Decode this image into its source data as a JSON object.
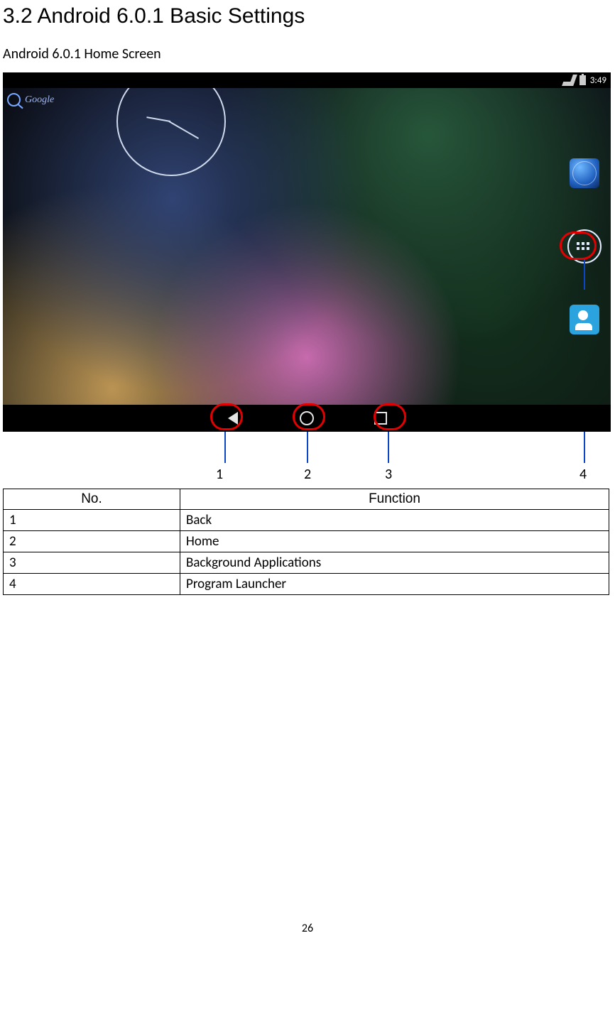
{
  "heading": "3.2 Android 6.0.1 Basic Settings",
  "subhead": "Android 6.0.1 Home Screen",
  "statusbar": {
    "time": "3:49"
  },
  "search": {
    "label": "Google"
  },
  "callouts": {
    "labels": {
      "l1": "1",
      "l2": "2",
      "l3": "3",
      "l4": "4"
    }
  },
  "table": {
    "headers": {
      "no": "No.",
      "function": "Function"
    },
    "rows": [
      {
        "no": "1",
        "fn": "Back"
      },
      {
        "no": "2",
        "fn": "Home"
      },
      {
        "no": "3",
        "fn": "Background Applications"
      },
      {
        "no": "4",
        "fn": "Program Launcher"
      }
    ]
  },
  "page_number": "26"
}
